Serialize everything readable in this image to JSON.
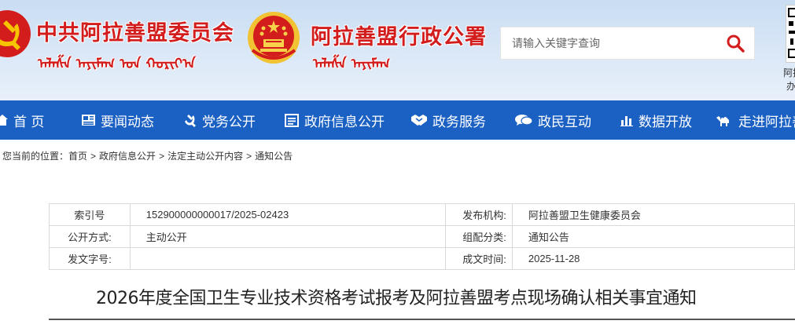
{
  "header": {
    "party_committee_title": "中共阿拉善盟委员会",
    "party_committee_mongolian": "ᠠᠯᠠᠱᠠ ᠠᠶᠢᠮᠠᠭ ᠤᠨ ᠬᠣᠷᠢᠶ᠎ᠠ",
    "administration_title": "阿拉善盟行政公署",
    "administration_mongolian": "ᠠᠯᠠᠱᠠ ᠠᠶᠢᠮᠠᠭ",
    "qr_caption": [
      "阿拉",
      "办"
    ]
  },
  "search": {
    "placeholder": "请输入关键字查询"
  },
  "nav": {
    "items": [
      {
        "label": "首 页",
        "icon": "home-icon"
      },
      {
        "label": "要闻动态",
        "icon": "newspaper-icon"
      },
      {
        "label": "党务公开",
        "icon": "party-emblem-icon"
      },
      {
        "label": "政府信息公开",
        "icon": "document-icon"
      },
      {
        "label": "政务服务",
        "icon": "handshake-icon"
      },
      {
        "label": "政民互动",
        "icon": "chat-icon"
      },
      {
        "label": "数据开放",
        "icon": "bar-chart-icon"
      },
      {
        "label": "走进阿拉善",
        "icon": "camel-icon"
      }
    ]
  },
  "breadcrumb": {
    "prefix": "您当前的位置：",
    "items": [
      "首页",
      "政府信息公开",
      "法定主动公开内容",
      "通知公告"
    ],
    "separator": ">"
  },
  "meta": {
    "index_label": "索引号",
    "index_value": "152900000000017/2025-02423",
    "publisher_label": "发布机构:",
    "publisher_value": "阿拉善盟卫生健康委员会",
    "disclosure_label": "公开方式:",
    "disclosure_value": "主动公开",
    "category_label": "组配分类:",
    "category_value": "通知公告",
    "docno_label": "发文字号:",
    "docno_value": "",
    "date_label": "成文时间:",
    "date_value": "2025-11-28"
  },
  "article": {
    "title": "2026年度全国卫生专业技术资格考试报考及阿拉善盟考点现场确认相关事宜通知"
  },
  "colors": {
    "nav_bg": "#1b61c4",
    "brand_red": "#d31d1d",
    "header_bg": "#d4e4f6"
  }
}
